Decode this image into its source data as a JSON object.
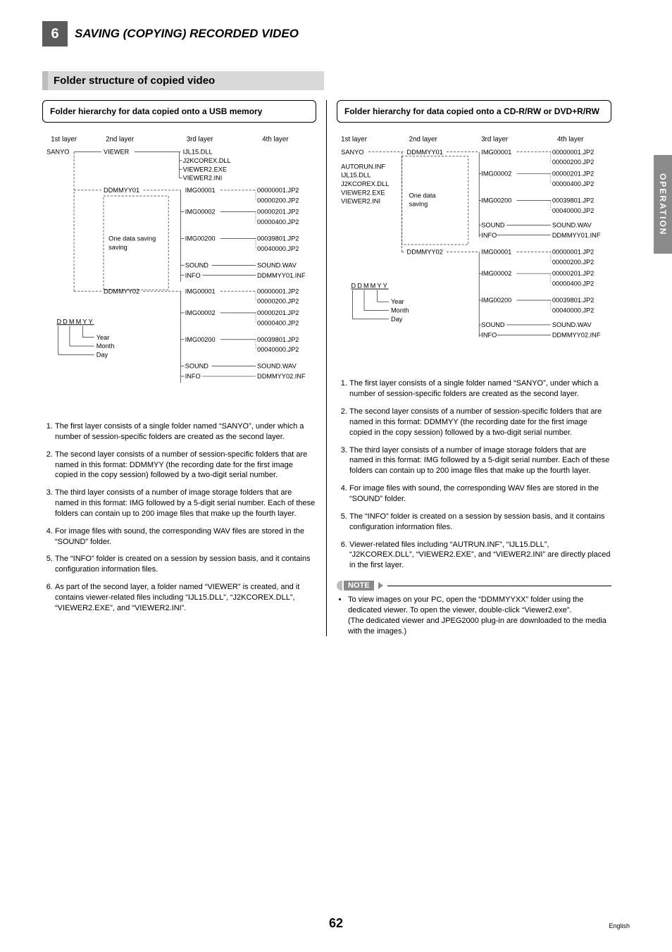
{
  "header": {
    "chapter_number": "6",
    "chapter_title": "SAVING (COPYING) RECORDED VIDEO"
  },
  "section_title": "Folder structure of copied video",
  "side_tab": "OPERATION",
  "page_number": "62",
  "page_lang": "English",
  "left": {
    "panel_title": "Folder hierarchy for data copied onto a USB memory",
    "layers": {
      "l1": "1st layer",
      "l2": "2nd layer",
      "l3": "3rd layer",
      "l4": "4th layer"
    },
    "tree": {
      "root": "SANYO",
      "viewer": "VIEWER",
      "viewer_files": [
        "IJL15.DLL",
        "J2KCOREX.DLL",
        "VIEWER2.EXE",
        "VIEWER2.INI"
      ],
      "s1": "DDMMYY01",
      "anno1": "One data saving",
      "s2": "DDMMYY02",
      "img1": "IMG00001",
      "img2": "IMG00002",
      "img3": "IMG00200",
      "sound": "SOUND",
      "info": "INFO",
      "f1a": "00000001.JP2",
      "f1b": "00000200.JP2",
      "f2a": "00000201.JP2",
      "f2b": "00000400.JP2",
      "f3a": "00039801.JP2",
      "f3b": "00040000.JP2",
      "snd": "SOUND.WAV",
      "inf1": "DDMMYY01.INF",
      "b_img1": "IMG00001",
      "b_img2": "IMG00002",
      "b_img3": "IMG00200",
      "b_sound": "SOUND",
      "b_info": "INFO",
      "bf1a": "00000001.JP2",
      "bf1b": "00000200.JP2",
      "bf2a": "00000201.JP2",
      "bf2b": "00000400.JP2",
      "bf3a": "00039801.JP2",
      "bf3b": "00040000.JP2",
      "bsnd": "SOUND.WAV",
      "binf": "DDMMYY02.INF",
      "legend_root": "DDMMYY",
      "legend_y": "Year",
      "legend_m": "Month",
      "legend_d": "Day"
    },
    "explain": [
      "The first layer consists of a single folder named “SANYO”, under which a number of session-specific folders are created as the second layer.",
      "The second layer consists of a number of session-specific folders that are named in this format: DDMMYY (the recording date for the first image copied in the copy session) followed by a two-digit serial number.",
      "The third layer consists of a number of image storage folders that are named in this format: IMG followed by a 5-digit serial number. Each of these folders can contain up to 200 image files that make up the fourth layer.",
      "For image files with sound, the corresponding WAV files are stored in the “SOUND” folder.",
      "The “INFO” folder is created on a session by session basis, and it contains configuration information files.",
      "As part of the second layer, a folder named “VIEWER” is created, and it contains viewer-related files including “IJL15.DLL”, “J2KCOREX.DLL”, “VIEWER2.EXE”, and “VIEWER2.INI”."
    ]
  },
  "right": {
    "panel_title": "Folder hierarchy for data copied onto a CD-R/RW or DVD+R/RW",
    "layers": {
      "l1": "1st layer",
      "l2": "2nd layer",
      "l3": "3rd layer",
      "l4": "4th layer"
    },
    "tree": {
      "root": "SANYO",
      "root_files": [
        "AUTORUN.INF",
        "IJL15.DLL",
        "J2KCOREX.DLL",
        "VIEWER2.EXE",
        "VIEWER2.INI"
      ],
      "s1": "DDMMYY01",
      "anno1": "One data saving",
      "s2": "DDMMYY02",
      "img1": "IMG00001",
      "img2": "IMG00002",
      "img3": "IMG00200",
      "sound": "SOUND",
      "info": "INFO",
      "f1a": "00000001.JP2",
      "f1b": "00000200.JP2",
      "f2a": "00000201.JP2",
      "f2b": "00000400.JP2",
      "f3a": "00039801.JP2",
      "f3b": "00040000.JP2",
      "snd": "SOUND.WAV",
      "inf1": "DDMMYY01.INF",
      "b_img1": "IMG00001",
      "b_img2": "IMG00002",
      "b_img3": "IMG00200",
      "b_sound": "SOUND",
      "b_info": "INFO",
      "bf1a": "00000001.JP2",
      "bf1b": "00000200.JP2",
      "bf2a": "00000201.JP2",
      "bf2b": "00000400.JP2",
      "bf3a": "00039801.JP2",
      "bf3b": "00040000.JP2",
      "bsnd": "SOUND.WAV",
      "binf": "DDMMYY02.INF",
      "legend_root": "DDMMYY",
      "legend_y": "Year",
      "legend_m": "Month",
      "legend_d": "Day"
    },
    "explain": [
      "The first layer consists of a single folder named “SANYO”, under which a number of session-specific folders are created as the second layer.",
      "The second layer consists of a number of session-specific folders that are named in this format: DDMMYY (the recording date for the first image copied in the copy session) followed by a two-digit serial number.",
      "The third layer consists of a number of image storage folders that are named in this format: IMG followed by a 5-digit serial number. Each of these folders can contain up to 200 image files that make up the fourth layer.",
      "For image files with sound, the corresponding WAV files are stored in the “SOUND” folder.",
      "The “INFO” folder is created on a session by session basis, and it contains configuration information files.",
      "Viewer-related files including “AUTRUN.INF”, “IJL15.DLL”, “J2KCOREX.DLL”, “VIEWER2.EXE”, and “VIEWER2.INI” are directly placed in the first layer."
    ],
    "note_label": "NOTE",
    "note_text": "To view images on your PC, open the “DDMMYYXX” folder using the dedicated viewer. To open the viewer, double-click “Viewer2.exe”.\n(The dedicated viewer and JPEG2000 plug-in are downloaded to the media with the images.)"
  }
}
